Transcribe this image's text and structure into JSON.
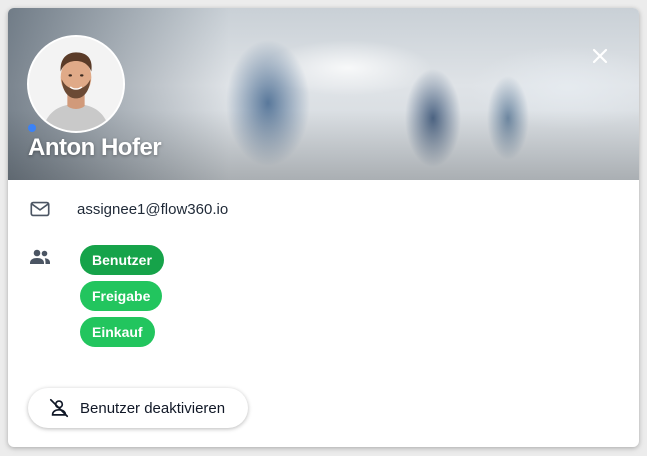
{
  "profile": {
    "name": "Anton Hofer",
    "status_color": "#3b82f6"
  },
  "contact": {
    "email": "assignee1@flow360.io"
  },
  "groups": [
    {
      "label": "Benutzer"
    },
    {
      "label": "Freigabe"
    },
    {
      "label": "Einkauf"
    }
  ],
  "actions": {
    "deactivate_label": "Benutzer deaktivieren",
    "close_icon": "close-icon"
  },
  "colors": {
    "chip_green": "#22c55e",
    "chip_green_dark": "#16a34a"
  }
}
